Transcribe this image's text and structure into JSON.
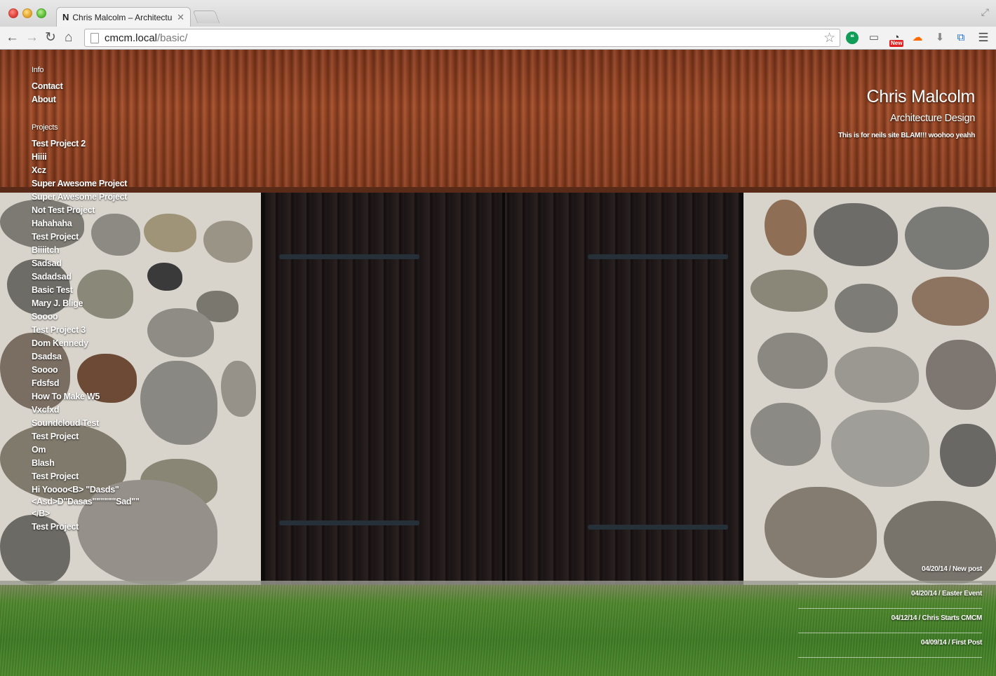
{
  "browser": {
    "tab_title": "Chris Malcolm – Architectu",
    "tab_favicon": "N",
    "url_host": "cmcm.local",
    "url_path": "/basic/",
    "extension_badge": "New"
  },
  "icons": {
    "back": "back-arrow-icon",
    "forward": "forward-arrow-icon",
    "reload": "reload-icon",
    "home": "home-icon",
    "bookmark": "star-icon",
    "menu": "hamburger-menu-icon"
  },
  "sidebar": {
    "info_label": "Info",
    "info_items": [
      "Contact",
      "About"
    ],
    "projects_label": "Projects",
    "projects": [
      "Test Project 2",
      "Hiiii",
      "Xcz",
      "Super Awesome Project",
      "Super Awesome Project",
      "Not Test Project",
      "Hahahaha",
      "Test Project",
      "Biiiitch",
      "Sadsad",
      "Sadadsad",
      "Basic Test",
      "Mary J. Blige",
      "Soooo",
      "Test Project 3",
      "Dom Kennedy",
      "Dsadsa",
      "Soooo",
      "Fdsfsd",
      "How To Make W5",
      "Vxcfxd",
      "Soundcloud Test",
      "Test Project",
      "Om",
      "Blash",
      "Test Project",
      "Hi Yoooo<B> \"Dasds\" <Asd>D\"Dasas\"\"\"\"\"\"Sad\"\" </B>",
      "Test Project"
    ]
  },
  "header": {
    "title": "Chris Malcolm",
    "subtitle": "Architecture Design",
    "tagline": "This is for neils site BLAM!!! woohoo yeahh"
  },
  "posts": [
    "04/20/14 / New post",
    "04/20/14 / Easter Event",
    "04/12/14 / Chris Starts CMCM",
    "04/09/14 / First Post"
  ],
  "colors": {
    "roof": "#a44a24",
    "door": "#1e1818",
    "grass": "#4f8a2c",
    "overlay_text": "#ffffff"
  }
}
